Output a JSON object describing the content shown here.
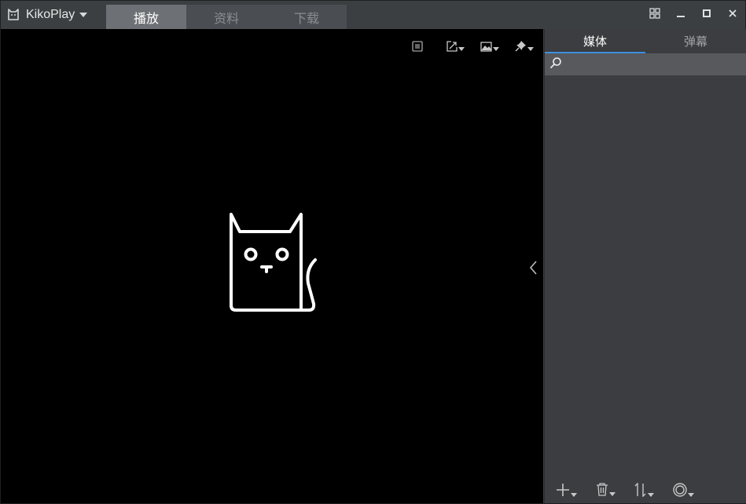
{
  "app": {
    "title": "KikoPlay"
  },
  "tabs": [
    {
      "label": "播放",
      "active": true
    },
    {
      "label": "资料",
      "active": false
    },
    {
      "label": "下载",
      "active": false
    }
  ],
  "window_controls": [
    "grid-icon",
    "minimize-icon",
    "maximize-icon",
    "close-icon"
  ],
  "player_toolbar": [
    "list-icon",
    "window-size-icon",
    "screenshot-icon",
    "pin-icon"
  ],
  "side_panel": {
    "tabs": [
      {
        "label": "媒体",
        "active": true
      },
      {
        "label": "弹幕",
        "active": false
      }
    ],
    "search": {
      "value": "",
      "placeholder": ""
    },
    "bottom_actions": [
      "add-icon",
      "delete-icon",
      "sort-icon",
      "loop-mode-icon"
    ]
  },
  "colors": {
    "accent": "#3d8ee0",
    "player_bg": "#000000",
    "panel_bg": "#3b3d40"
  }
}
